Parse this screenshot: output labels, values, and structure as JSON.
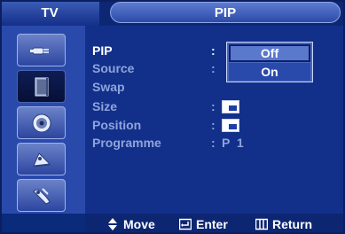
{
  "header": {
    "menu": "TV",
    "title": "PIP"
  },
  "side_icons": [
    {
      "name": "input-plug-icon",
      "active": false
    },
    {
      "name": "picture-icon",
      "active": true
    },
    {
      "name": "sound-icon",
      "active": false
    },
    {
      "name": "channel-icon",
      "active": false
    },
    {
      "name": "setup-icon",
      "active": false
    }
  ],
  "menu_rows": [
    {
      "label": "PIP",
      "sep": ":",
      "value": "",
      "enabled": true
    },
    {
      "label": "Source",
      "sep": ":",
      "value": "",
      "enabled": false
    },
    {
      "label": "Swap",
      "sep": "",
      "value": "",
      "enabled": false
    },
    {
      "label": "Size",
      "sep": ":",
      "value": "",
      "enabled": false
    },
    {
      "label": "Position",
      "sep": ":",
      "value": "",
      "enabled": false
    },
    {
      "label": "Programme",
      "sep": ":",
      "value": "P  1",
      "enabled": false
    }
  ],
  "dropdown": {
    "options": [
      "Off",
      "On"
    ],
    "selected": "Off"
  },
  "footer": {
    "move": "Move",
    "enter": "Enter",
    "return": "Return"
  },
  "colors": {
    "bg": "#12308a",
    "highlight": "#5a78cc",
    "text": "#ffffff",
    "dim_text": "#8fa4dc"
  }
}
